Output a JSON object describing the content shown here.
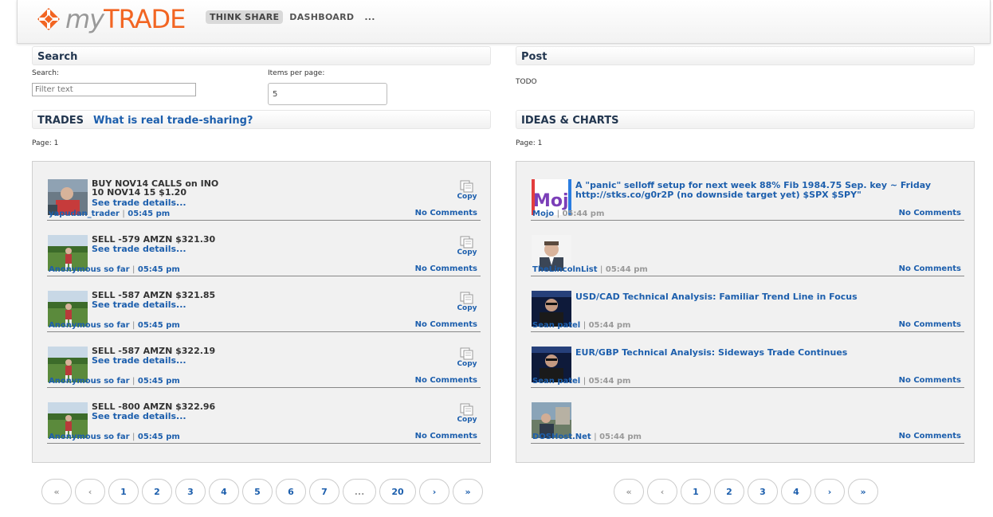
{
  "brand": {
    "my": "my",
    "trade": "TRADE",
    "accent": "#f26522",
    "link_color": "#1d5fad"
  },
  "nav": {
    "items": [
      "THINK SHARE",
      "DASHBOARD",
      "..."
    ]
  },
  "search": {
    "header": "Search",
    "search_label": "Search:",
    "filter_placeholder": "Filter text",
    "items_label": "Items per page:",
    "items_value": "5"
  },
  "post": {
    "header": "Post",
    "body": "TODO"
  },
  "trades": {
    "header": "TRADES",
    "header_link": "What is real trade-sharing?",
    "page_label": "Page: 1",
    "rows": [
      {
        "title_1": "BUY NOV14 CALLS on INO",
        "title_2": "10 NOV14 15 $1.20",
        "details": "See trade details...",
        "copy": "Copy",
        "author": "yapudan_trader",
        "time": "05:45 pm",
        "comments": "No Comments"
      },
      {
        "title_1": "SELL -579 AMZN $321.30",
        "title_2": "",
        "details": "See trade details...",
        "copy": "Copy",
        "author": "Anonymous so far",
        "time": "05:45 pm",
        "comments": "No Comments"
      },
      {
        "title_1": "SELL -587 AMZN $321.85",
        "title_2": "",
        "details": "See trade details...",
        "copy": "Copy",
        "author": "Anonymous so far",
        "time": "05:45 pm",
        "comments": "No Comments"
      },
      {
        "title_1": "SELL -587 AMZN $322.19",
        "title_2": "",
        "details": "See trade details...",
        "copy": "Copy",
        "author": "Anonymous so far",
        "time": "05:45 pm",
        "comments": "No Comments"
      },
      {
        "title_1": "SELL -800 AMZN $322.96",
        "title_2": "",
        "details": "See trade details...",
        "copy": "Copy",
        "author": "Anonymous so far",
        "time": "05:45 pm",
        "comments": "No Comments"
      }
    ],
    "pager": [
      "«",
      "‹",
      "1",
      "2",
      "3",
      "4",
      "5",
      "6",
      "7",
      "...",
      "20",
      "›",
      "»"
    ]
  },
  "ideas": {
    "header": "IDEAS & CHARTS",
    "page_label": "Page: 1",
    "rows": [
      {
        "title": "A \"panic\" selloff setup for next week 88% Fib 1984.75 Sep. key ~ Friday http://stks.co/g0r2P (no downside target yet) $SPX $SPY\"",
        "author": "Mojo",
        "time": "05:44 pm",
        "comments": "No Comments",
        "avatar_text": "Mojo"
      },
      {
        "title": "",
        "author": "TheLincolnList",
        "time": "05:44 pm",
        "comments": "No Comments"
      },
      {
        "title": "USD/CAD Technical Analysis: Familiar Trend Line in Focus",
        "author": "Sean patel",
        "time": "05:44 pm",
        "comments": "No Comments"
      },
      {
        "title": "EUR/GBP Technical Analysis: Sideways Trade Continues",
        "author": "Sean patel",
        "time": "05:44 pm",
        "comments": "No Comments"
      },
      {
        "title": "",
        "author": "DOSHost.Net",
        "time": "05:44 pm",
        "comments": "No Comments"
      }
    ],
    "pager": [
      "«",
      "‹",
      "1",
      "2",
      "3",
      "4",
      "›",
      "»"
    ]
  }
}
